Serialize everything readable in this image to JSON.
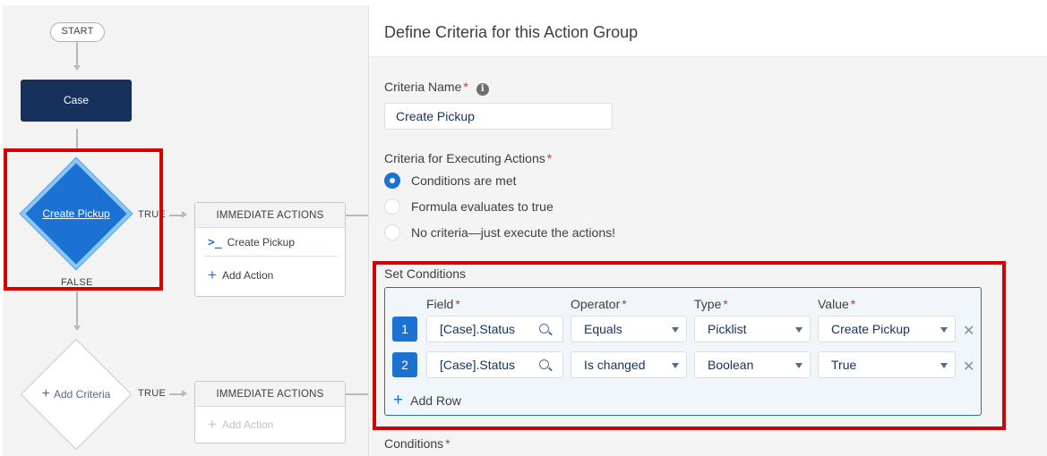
{
  "canvas": {
    "start_label": "START",
    "case_label": "Case",
    "criteria_node_label": "Create Pickup",
    "true_label": "TRUE",
    "false_label": "FALSE",
    "add_criteria_label": "Add Criteria",
    "action_group_1": {
      "header": "IMMEDIATE ACTIONS",
      "action_label": "Create Pickup",
      "add_action_label": "Add Action"
    },
    "action_group_2": {
      "header": "IMMEDIATE ACTIONS",
      "add_action_label": "Add Action"
    }
  },
  "panel": {
    "title": "Define Criteria for this Action Group",
    "criteria_name_label": "Criteria Name",
    "criteria_name_value": "Create Pickup",
    "executing_label": "Criteria for Executing Actions",
    "options": [
      {
        "label": "Conditions are met",
        "selected": true
      },
      {
        "label": "Formula evaluates to true",
        "selected": false
      },
      {
        "label": "No criteria—just execute the actions!",
        "selected": false
      }
    ],
    "set_conditions_label": "Set Conditions",
    "columns": {
      "field": "Field",
      "operator": "Operator",
      "type": "Type",
      "value": "Value"
    },
    "rows": [
      {
        "num": "1",
        "field": "[Case].Status",
        "operator": "Equals",
        "type": "Picklist",
        "value": "Create Pickup"
      },
      {
        "num": "2",
        "field": "[Case].Status",
        "operator": "Is changed",
        "type": "Boolean",
        "value": "True"
      }
    ],
    "add_row_label": "Add Row",
    "conditions_label": "Conditions",
    "required_mark": "*",
    "info_glyph": "i",
    "delete_glyph": "✕"
  },
  "colors": {
    "brand_blue": "#1b72d2",
    "node_navy": "#16325c",
    "highlight_red": "#d50000",
    "required_red": "#c23934"
  }
}
